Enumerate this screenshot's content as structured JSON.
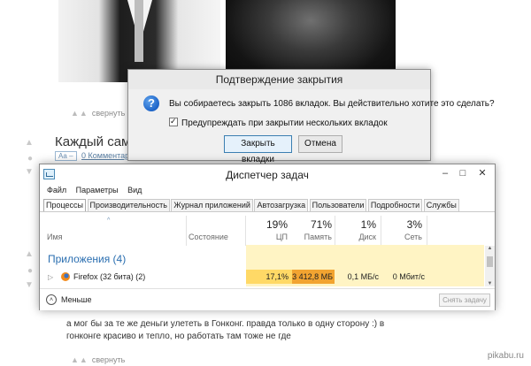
{
  "page": {
    "collapse_label": "свернуть",
    "post_title": "Каждый сам",
    "badge": "Аа –",
    "comments_link": "0 Комментар",
    "comment_text": "а мог бы за те же деньги улететь в Гонконг. правда только в одну сторону :) в гонконге красиво и тепло, но работать там тоже не где",
    "watermark": "pikabu.ru"
  },
  "dialog": {
    "title": "Подтверждение закрытия",
    "message": "Вы собираетесь закрыть 1086 вкладок. Вы действительно хотите это сделать?",
    "checkbox_label": "Предупреждать при закрытии нескольких вкладок",
    "checkbox_checked": true,
    "confirm_button": "Закрыть вкладки",
    "cancel_button": "Отмена",
    "icon": "question-icon"
  },
  "task_manager": {
    "title": "Диспетчер задач",
    "menu": [
      "Файл",
      "Параметры",
      "Вид"
    ],
    "tabs": [
      "Процессы",
      "Производительность",
      "Журнал приложений",
      "Автозагрузка",
      "Пользователи",
      "Подробности",
      "Службы"
    ],
    "active_tab": "Процессы",
    "columns": {
      "name": "Имя",
      "status": "Состояние",
      "cpu": {
        "percent": "19%",
        "label": "ЦП"
      },
      "memory": {
        "percent": "71%",
        "label": "Память"
      },
      "disk": {
        "percent": "1%",
        "label": "Диск"
      },
      "network": {
        "percent": "3%",
        "label": "Сеть"
      }
    },
    "group_label": "Приложения (4)",
    "process": {
      "name": "Firefox (32 бита) (2)",
      "cpu": "17,1%",
      "memory": "3 412,8 МБ",
      "disk": "0,1 МБ/с",
      "network": "0 Мбит/с"
    },
    "less_label": "Меньше",
    "end_task_label": "Снять задачу"
  },
  "colors": {
    "heat_light": "#fff4c4",
    "heat_cpu": "#ffd966",
    "heat_memory": "#f2a431",
    "link_blue": "#2a6eb0"
  }
}
